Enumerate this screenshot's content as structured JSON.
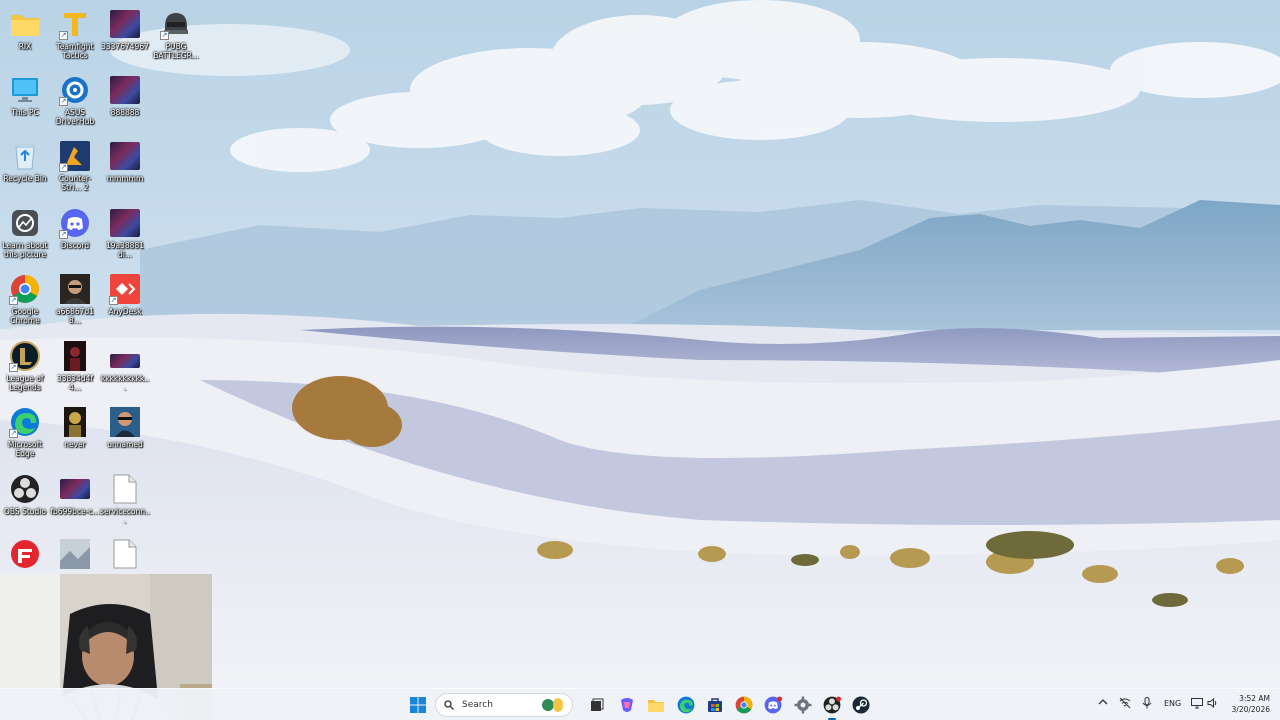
{
  "desktop": {
    "icons": [
      {
        "label": "RIX",
        "icon": "folder-icon"
      },
      {
        "label": "Teamfight Tactics",
        "icon": "teamfight-tactics-icon"
      },
      {
        "label": "3337674967",
        "icon": "image-file-icon"
      },
      {
        "label": "PUBG BATTLEGR...",
        "icon": "pubg-icon"
      },
      {
        "label": "This PC",
        "icon": "this-pc-icon"
      },
      {
        "label": "ASUS DriverHub",
        "icon": "asus-driverhub-icon"
      },
      {
        "label": "888888",
        "icon": "image-file-icon"
      },
      {
        "label": "Recycle Bin",
        "icon": "recycle-bin-icon"
      },
      {
        "label": "Counter-Stri... 2",
        "icon": "counter-strike-icon"
      },
      {
        "label": "mmmmm",
        "icon": "image-file-icon"
      },
      {
        "label": "Learn about this picture",
        "icon": "learn-picture-icon"
      },
      {
        "label": "Discord",
        "icon": "discord-icon"
      },
      {
        "label": "19a38881 di...",
        "icon": "image-file-icon"
      },
      {
        "label": "Google Chrome",
        "icon": "chrome-icon"
      },
      {
        "label": "a66867d1 8...",
        "icon": "photo-file-icon"
      },
      {
        "label": "AnyDesk",
        "icon": "anydesk-icon"
      },
      {
        "label": "League of Legends",
        "icon": "league-of-legends-icon"
      },
      {
        "label": "33834d4f 4...",
        "icon": "photo-file-icon"
      },
      {
        "label": "kkkkkkkkkk...",
        "icon": "image-file-icon"
      },
      {
        "label": "Microsoft Edge",
        "icon": "edge-icon"
      },
      {
        "label": "never",
        "icon": "photo-file-icon"
      },
      {
        "label": "unnamed",
        "icon": "photo-file-icon"
      },
      {
        "label": "OBS Studio",
        "icon": "obs-icon"
      },
      {
        "label": "fb699bce-c...",
        "icon": "image-file-icon"
      },
      {
        "label": "serviceconn...",
        "icon": "blank-file-icon"
      },
      {
        "label": "",
        "icon": "faceit-icon"
      },
      {
        "label": "",
        "icon": "image-file-icon"
      },
      {
        "label": "",
        "icon": "blank-file-icon"
      }
    ]
  },
  "taskbar": {
    "search_placeholder": "Search",
    "apps": [
      "start-icon",
      "search-icon",
      "widgets-icon",
      "task-view-icon",
      "copilot-icon",
      "file-explorer-icon",
      "edge-icon",
      "store-icon",
      "chrome-icon",
      "discord-icon",
      "settings-icon",
      "obs-icon",
      "steam-icon"
    ],
    "tray": {
      "language": "ENG",
      "time": "3:52 AM",
      "date": "3/20/2026"
    }
  },
  "colors": {
    "accent": "#0067c0",
    "taskbar_bg": "#eef2f8"
  }
}
